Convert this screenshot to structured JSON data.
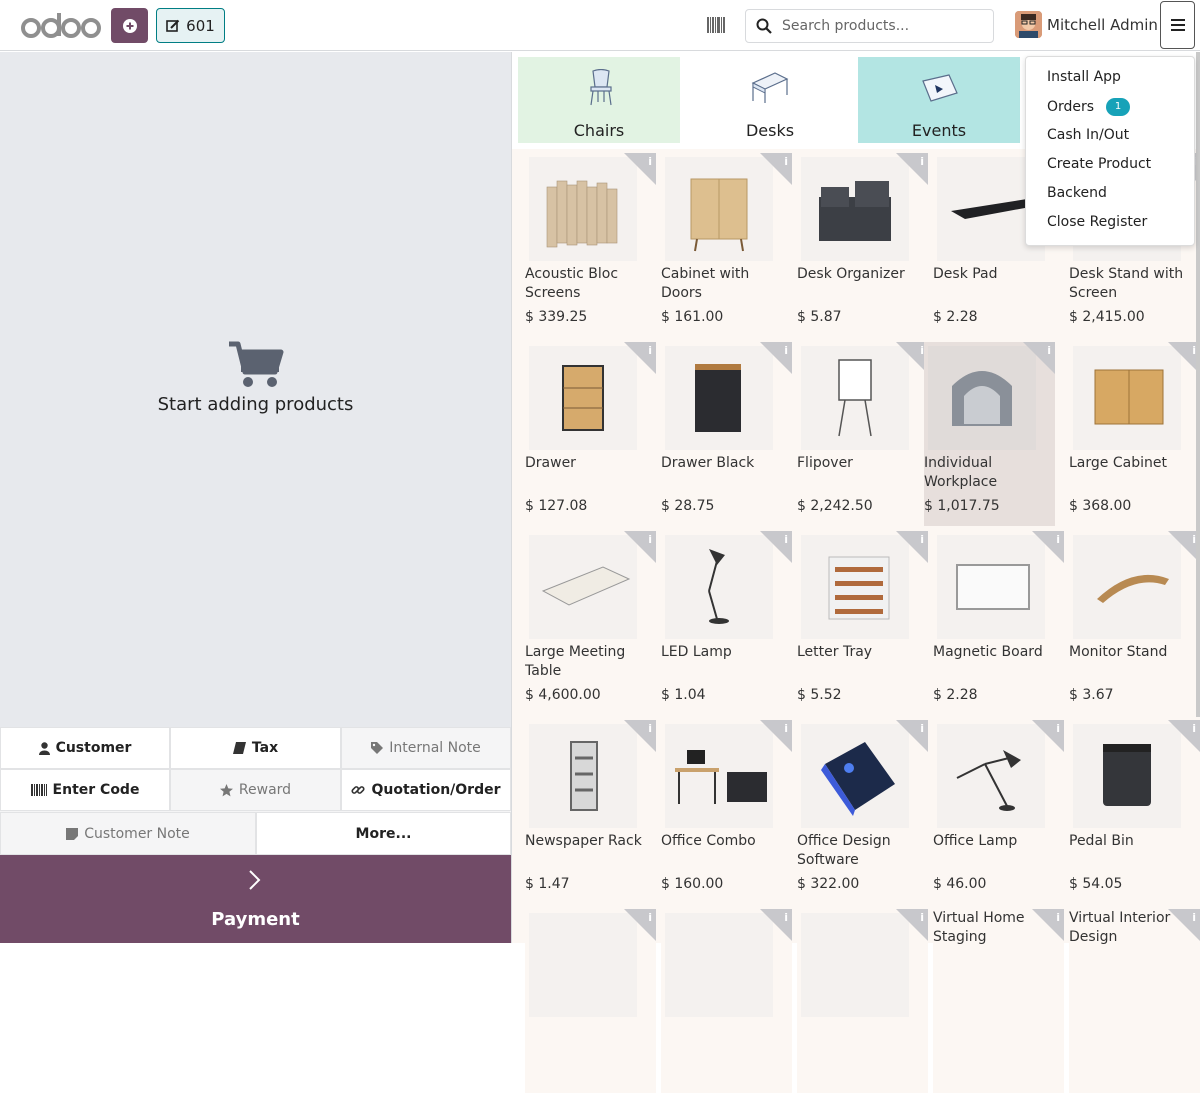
{
  "header": {
    "order_number": "601",
    "search_placeholder": "Search products...",
    "user_name": "Mitchell Admin"
  },
  "cart": {
    "empty_message": "Start adding products"
  },
  "controls": {
    "customer": "Customer",
    "tax": "Tax",
    "internal_note": "Internal Note",
    "enter_code": "Enter Code",
    "reward": "Reward",
    "quotation_order": "Quotation/Order",
    "customer_note": "Customer Note",
    "more": "More..."
  },
  "payment_label": "Payment",
  "categories": [
    {
      "label": "Chairs",
      "color": "#e2f3e3"
    },
    {
      "label": "Desks",
      "color": "#ffffff"
    },
    {
      "label": "Events",
      "color": "#b3e5e3"
    }
  ],
  "products": [
    {
      "name": "Acoustic Bloc Screens",
      "price": "$ 339.25",
      "icon": "screens-image"
    },
    {
      "name": "Cabinet with Doors",
      "price": "$ 161.00",
      "icon": "cabinet-image"
    },
    {
      "name": "Desk Organizer",
      "price": "$ 5.87",
      "icon": "organizer-image"
    },
    {
      "name": "Desk Pad",
      "price": "$ 2.28",
      "icon": "desk-pad-image"
    },
    {
      "name": "Desk Stand with Screen",
      "price": "$ 2,415.00",
      "icon": "desk-stand-image"
    },
    {
      "name": "Drawer",
      "price": "$ 127.08",
      "icon": "drawer-image"
    },
    {
      "name": "Drawer Black",
      "price": "$ 28.75",
      "icon": "drawer-black-image"
    },
    {
      "name": "Flipover",
      "price": "$ 2,242.50",
      "icon": "flipover-image"
    },
    {
      "name": "Individual Workplace",
      "price": "$ 1,017.75",
      "icon": "workplace-image"
    },
    {
      "name": "Large Cabinet",
      "price": "$ 368.00",
      "icon": "large-cabinet-image"
    },
    {
      "name": "Large Meeting Table",
      "price": "$ 4,600.00",
      "icon": "meeting-table-image"
    },
    {
      "name": "LED Lamp",
      "price": "$ 1.04",
      "icon": "led-lamp-image"
    },
    {
      "name": "Letter Tray",
      "price": "$ 5.52",
      "icon": "letter-tray-image"
    },
    {
      "name": "Magnetic Board",
      "price": "$ 2.28",
      "icon": "magnetic-board-image"
    },
    {
      "name": "Monitor Stand",
      "price": "$ 3.67",
      "icon": "monitor-stand-image"
    },
    {
      "name": "Newspaper Rack",
      "price": "$ 1.47",
      "icon": "newspaper-rack-image"
    },
    {
      "name": "Office Combo",
      "price": "$ 160.00",
      "icon": "office-combo-image"
    },
    {
      "name": "Office Design Software",
      "price": "$ 322.00",
      "icon": "software-box-image"
    },
    {
      "name": "Office Lamp",
      "price": "$ 46.00",
      "icon": "office-lamp-image"
    },
    {
      "name": "Pedal Bin",
      "price": "$ 54.05",
      "icon": "pedal-bin-image"
    },
    {
      "name": "",
      "price": "",
      "icon": "product-image"
    },
    {
      "name": "",
      "price": "",
      "icon": "product-image"
    },
    {
      "name": "",
      "price": "",
      "icon": "product-image"
    },
    {
      "name": "Virtual Home Staging",
      "price": "",
      "icon": "product-image"
    },
    {
      "name": "Virtual Interior Design",
      "price": "",
      "icon": "product-image"
    }
  ],
  "menu": {
    "install_app": "Install App",
    "orders": "Orders",
    "orders_badge": "1",
    "cash_in_out": "Cash In/Out",
    "create_product": "Create Product",
    "backend": "Backend",
    "close_register": "Close Register"
  },
  "brand_color": "#714b67",
  "info_icon_text": "i"
}
